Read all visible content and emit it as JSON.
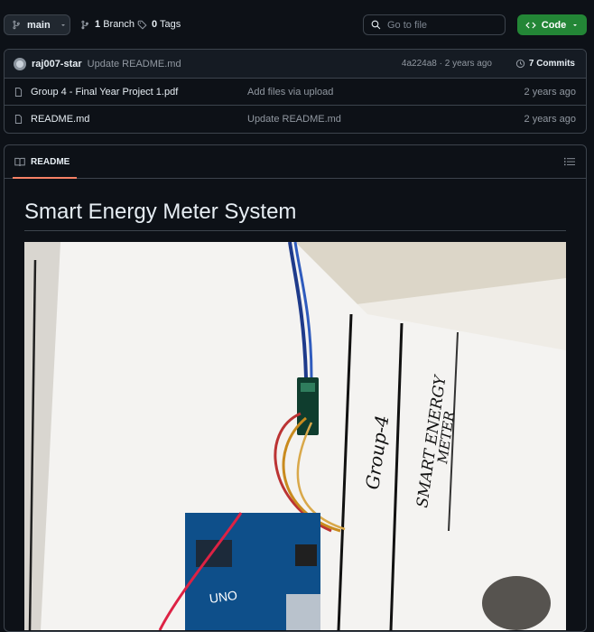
{
  "toolbar": {
    "branch_label": "main",
    "branch_count": "1",
    "branch_word": "Branch",
    "tag_count": "0",
    "tag_word": "Tags",
    "search_placeholder": "Go to file",
    "code_label": "Code"
  },
  "latest_commit": {
    "author": "raj007-star",
    "message": "Update README.md",
    "meta": "4a224a8 · 2 years ago",
    "commits_label": "7 Commits"
  },
  "files": [
    {
      "name": "Group 4 - Final Year Project 1.pdf",
      "commit": "Add files via upload",
      "time": "2 years ago"
    },
    {
      "name": "README.md",
      "commit": "Update README.md",
      "time": "2 years ago"
    }
  ],
  "readme": {
    "tab_label": "README",
    "title": "Smart Energy Meter System",
    "photo_text_1": "Group-4",
    "photo_text_2": "SMART ENERGY",
    "photo_text_3": "METER",
    "board_label": "UNO"
  },
  "colors": {
    "background": "#0d1117",
    "border": "#3d444d",
    "accent_green": "#238636",
    "tab_underline": "#f78166"
  }
}
